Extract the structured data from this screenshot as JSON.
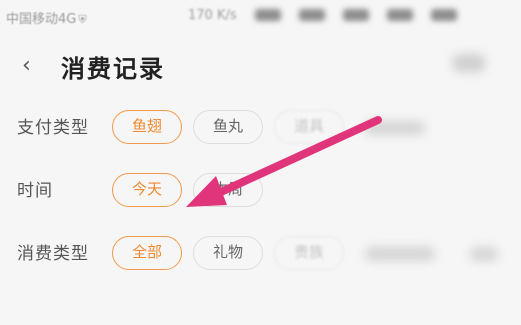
{
  "status_bar": {
    "carrier": "中国移动4G",
    "carrier_icon": "shield-icon",
    "speed": "170 K/s"
  },
  "header": {
    "title": "消费记录",
    "back_icon": "chevron-left-icon"
  },
  "filters": [
    {
      "label": "支付类型",
      "options": [
        {
          "text": "鱼翅",
          "state": "selected"
        },
        {
          "text": "鱼丸",
          "state": "normal"
        },
        {
          "text": "道具",
          "state": "blurred"
        }
      ]
    },
    {
      "label": "时间",
      "options": [
        {
          "text": "今天",
          "state": "selected"
        },
        {
          "text": "本周",
          "state": "normal"
        }
      ]
    },
    {
      "label": "消费类型",
      "options": [
        {
          "text": "全部",
          "state": "selected"
        },
        {
          "text": "礼物",
          "state": "normal"
        },
        {
          "text": "贵族",
          "state": "blurred"
        }
      ]
    }
  ],
  "colors": {
    "accent": "#ef8a32",
    "accent_border": "#f39a4c",
    "annotation_arrow": "#e0357a",
    "background": "#f6f6f6"
  },
  "annotation": {
    "type": "arrow",
    "points_to": "今天"
  }
}
